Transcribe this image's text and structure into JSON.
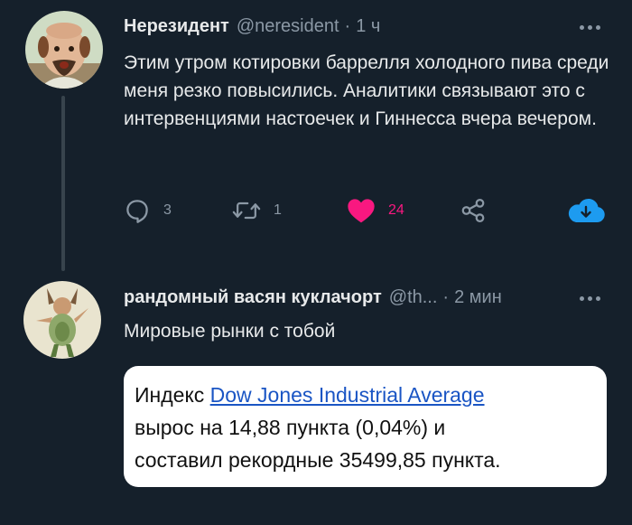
{
  "main_tweet": {
    "display_name": "Нерезидент",
    "handle": "@neresident",
    "separator": "·",
    "time": "1 ч",
    "text": "Этим утром котировки баррелля холодного пива среди меня резко повысились. Аналитики связывают это с интервенциями настоечек и Гиннесса вчера вечером.",
    "actions": {
      "reply_count": "3",
      "retweet_count": "1",
      "like_count": "24"
    },
    "icons": {
      "more": "more-icon",
      "reply": "reply-icon",
      "retweet": "retweet-icon",
      "like": "heart-icon",
      "share": "share-icon",
      "download": "cloud-download-icon"
    }
  },
  "reply_tweet": {
    "display_name": "рандомный васян куклачорт",
    "handle": "@th...",
    "separator": "·",
    "time": "2 мин",
    "text": "Мировые рынки с тобой",
    "embed": {
      "prefix": "Индекс ",
      "link_text": "Dow Jones Industrial Average",
      "line2": "вырос на 14,88 пункта (0,04%) и",
      "line3": "составил рекордные 35499,85 пункта."
    }
  },
  "colors": {
    "background": "#15202b",
    "text": "#e7e9ea",
    "muted": "#8b98a5",
    "like": "#f91880",
    "accent": "#1d9bf0"
  }
}
